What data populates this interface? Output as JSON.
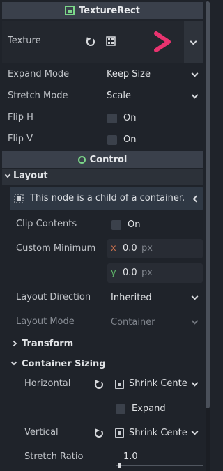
{
  "texture_rect": {
    "title": "TextureRect",
    "texture_label": "Texture",
    "expand_mode": {
      "label": "Expand Mode",
      "value": "Keep Size"
    },
    "stretch_mode": {
      "label": "Stretch Mode",
      "value": "Scale"
    },
    "flip_h": {
      "label": "Flip H",
      "value": "On"
    },
    "flip_v": {
      "label": "Flip V",
      "value": "On"
    }
  },
  "control": {
    "title": "Control",
    "layout": {
      "title": "Layout",
      "info": "This node is a child of a container.",
      "clip_contents": {
        "label": "Clip Contents",
        "value": "On"
      },
      "custom_minimum": {
        "label": "Custom Minimum",
        "x_axis": "x",
        "x_value": "0.0",
        "y_axis": "y",
        "y_value": "0.0",
        "unit": "px"
      },
      "layout_direction": {
        "label": "Layout Direction",
        "value": "Inherited"
      },
      "layout_mode": {
        "label": "Layout Mode",
        "value": "Container"
      }
    },
    "transform": {
      "title": "Transform"
    },
    "container_sizing": {
      "title": "Container Sizing",
      "horizontal": {
        "label": "Horizontal",
        "value": "Shrink Cente"
      },
      "expand": {
        "label": "Expand"
      },
      "vertical": {
        "label": "Vertical",
        "value": "Shrink Cente"
      },
      "stretch_ratio": {
        "label": "Stretch Ratio",
        "value": "1.0"
      }
    }
  },
  "colors": {
    "accent_green": "#7cd98a",
    "arrow_magenta": "#e8336f",
    "arrow_purple": "#7a2fc4",
    "axis_x": "#c9704d",
    "axis_y": "#5fb86a"
  }
}
